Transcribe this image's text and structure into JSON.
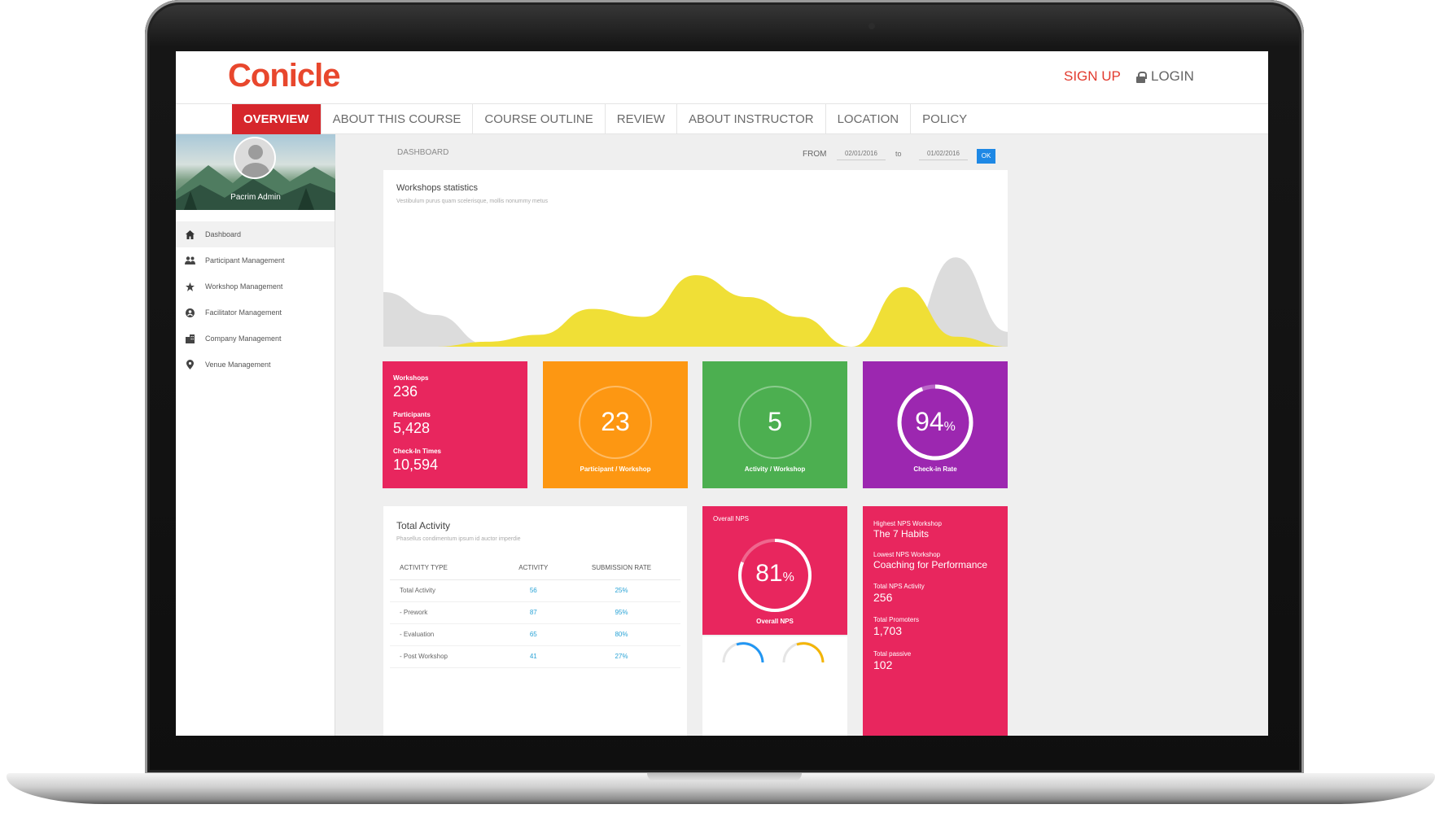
{
  "brand": {
    "name": "Conicle"
  },
  "header": {
    "signup_label": "SIGN UP",
    "login_label": "LOGIN"
  },
  "nav": {
    "items": [
      {
        "label": "OVERVIEW",
        "active": true
      },
      {
        "label": "ABOUT THIS COURSE"
      },
      {
        "label": "COURSE OUTLINE"
      },
      {
        "label": "REVIEW"
      },
      {
        "label": "ABOUT INSTRUCTOR"
      },
      {
        "label": "LOCATION"
      },
      {
        "label": "POLICY"
      }
    ]
  },
  "sidebar": {
    "user_name": "Pacrim Admin",
    "items": [
      {
        "label": "Dashboard",
        "icon": "home-icon",
        "active": true
      },
      {
        "label": "Participant Management",
        "icon": "people-icon"
      },
      {
        "label": "Workshop Management",
        "icon": "star-icon"
      },
      {
        "label": "Facilitator Management",
        "icon": "user-circle-icon"
      },
      {
        "label": "Company Management",
        "icon": "building-icon"
      },
      {
        "label": "Venue Management",
        "icon": "location-pin-icon"
      }
    ]
  },
  "dashboard": {
    "title": "DASHBOARD",
    "from_label": "FROM",
    "from_date": "02/01/2016",
    "to_label": "to",
    "to_date": "01/02/2016",
    "ok_label": "OK"
  },
  "workshops_chart": {
    "title": "Workshops statistics",
    "subtitle": "Vestibulum purus quam scelerisque, mollis nonummy metus"
  },
  "chart_data": {
    "type": "area",
    "title": "Workshops statistics",
    "series": [
      {
        "values": [
          0.55,
          0.32,
          0.02,
          0.0,
          0.0,
          0.0,
          0.0,
          0.0,
          0.0,
          0.0,
          0.05,
          0.9,
          0.15
        ]
      },
      {
        "values": [
          0.0,
          0.0,
          0.05,
          0.12,
          0.38,
          0.3,
          0.72,
          0.5,
          0.3,
          0.0,
          0.6,
          0.1,
          0.0
        ]
      }
    ],
    "colors": [
      "#dcdcdc",
      "#f0df36"
    ]
  },
  "stats": {
    "workshops_label": "Workshops",
    "workshops_value": "236",
    "participants_label": "Participants",
    "participants_value": "5,428",
    "checkin_label": "Check-In Times",
    "checkin_value": "10,594"
  },
  "rings": [
    {
      "value": "23",
      "caption": "Participant / Workshop",
      "color": "#fd9712"
    },
    {
      "value": "5",
      "caption": "Activity / Workshop",
      "color": "#4caf50"
    },
    {
      "value": "94",
      "unit": "%",
      "caption": "Check-in Rate",
      "color": "#9c27b0",
      "fill": 0.94
    }
  ],
  "total_activity": {
    "title": "Total Activity",
    "subtitle": "Phasellus condimentum ipsum id auctor imperdie",
    "headers": [
      "ACTIVITY TYPE",
      "ACTIVITY",
      "SUBMISSION RATE"
    ],
    "rows": [
      [
        "Total Activity",
        "56",
        "25%"
      ],
      [
        "- Prework",
        "87",
        "95%"
      ],
      [
        "- Evaluation",
        "65",
        "80%"
      ],
      [
        "- Post Workshop",
        "41",
        "27%"
      ]
    ]
  },
  "nps": {
    "label": "Overall NPS",
    "value": "81",
    "unit": "%",
    "caption": "Overall NPS",
    "fill": 0.81
  },
  "highlights": {
    "highest_label": "Highest NPS Workshop",
    "highest_value": "The 7 Habits",
    "lowest_label": "Lowest NPS Workshop",
    "lowest_value": "Coaching for Performance",
    "total_activity_label": "Total NPS Activity",
    "total_activity_value": "256",
    "promoters_label": "Total Promoters",
    "promoters_value": "1,703",
    "passive_label": "Total passive",
    "passive_value": "102"
  }
}
